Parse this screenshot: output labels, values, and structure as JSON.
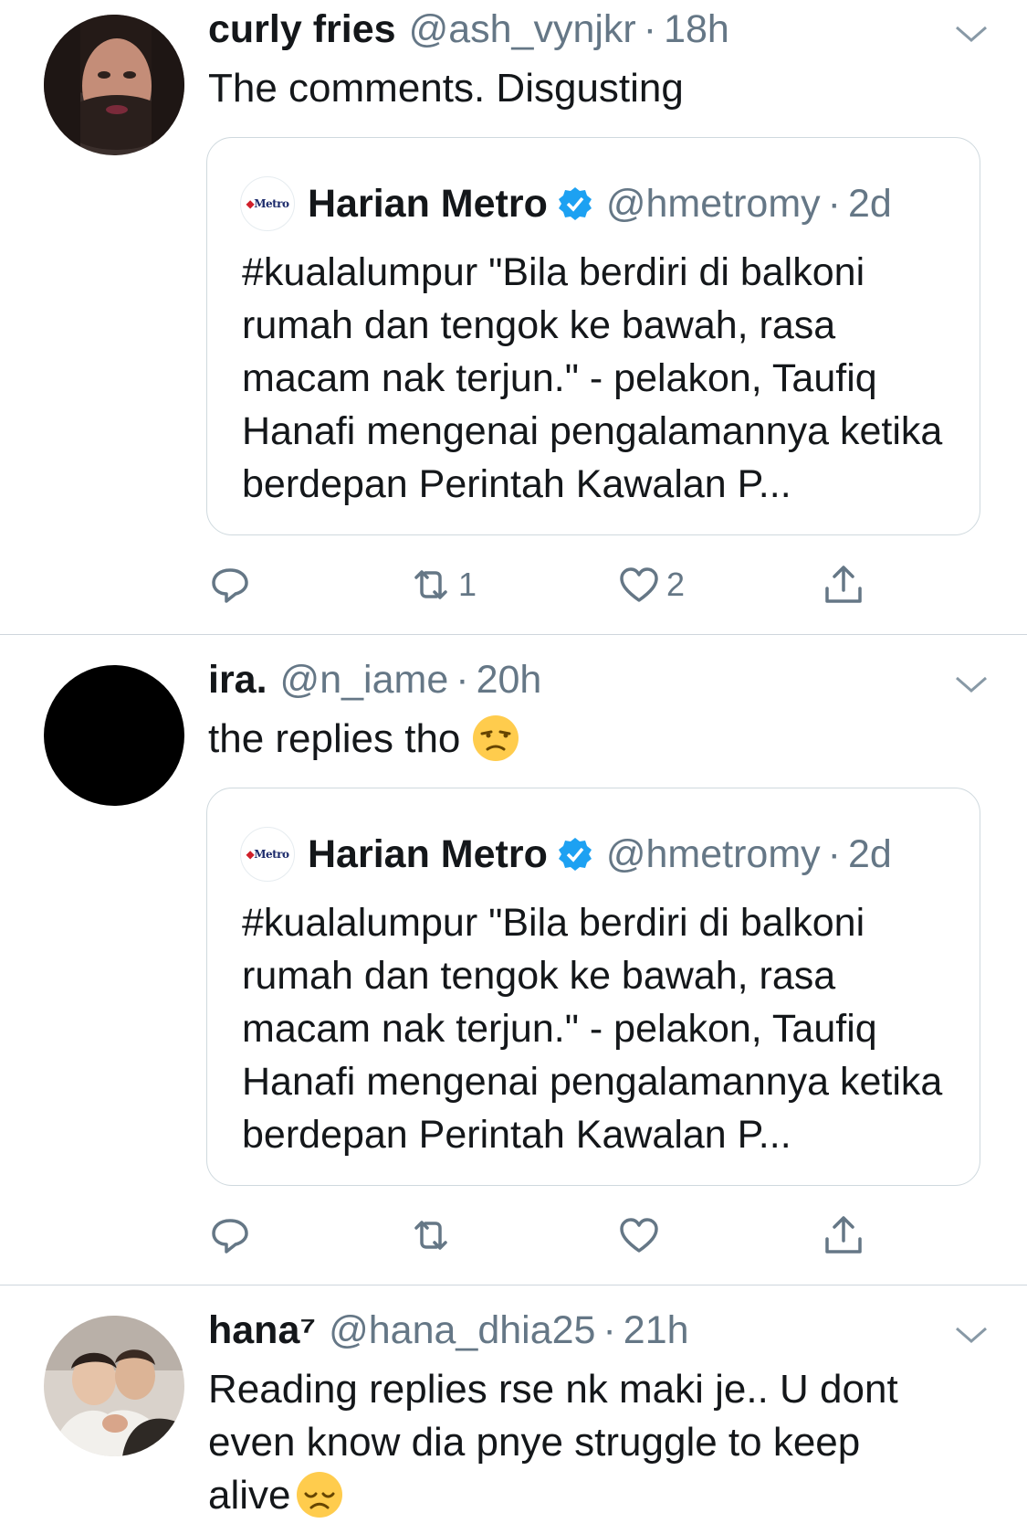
{
  "tweets": [
    {
      "name": "curly fries",
      "handle": "@ash_vynjkr",
      "time": "18h",
      "text": "The comments. Disgusting",
      "quote": {
        "logo_text": "Metro",
        "name": "Harian Metro",
        "handle": "@hmetromy",
        "time": "2d",
        "text": "#kualalumpur \"Bila berdiri di balkoni rumah dan tengok ke bawah, rasa macam nak terjun.\" - pelakon, Taufiq Hanafi mengenai pengalamannya ketika berdepan Perintah Kawalan P..."
      },
      "actions": {
        "reply": "",
        "retweet": "1",
        "like": "2"
      }
    },
    {
      "name": "ira.",
      "handle": "@n_iame",
      "time": "20h",
      "text": "the replies tho",
      "emoji": "unamused-face",
      "quote": {
        "logo_text": "Metro",
        "name": "Harian Metro",
        "handle": "@hmetromy",
        "time": "2d",
        "text": "#kualalumpur \"Bila berdiri di balkoni rumah dan tengok ke bawah, rasa macam nak terjun.\" - pelakon, Taufiq Hanafi mengenai pengalamannya ketika berdepan Perintah Kawalan P..."
      },
      "actions": {
        "reply": "",
        "retweet": "",
        "like": ""
      }
    },
    {
      "name": "hana⁷",
      "handle": "@hana_dhia25",
      "time": "21h",
      "text": "Reading replies rse nk maki je.. U dont even know dia pnye struggle to keep alive",
      "emoji": "disappointed-face"
    }
  ],
  "separator": "·",
  "colors": {
    "secondary": "#657786",
    "verified": "#1da1f2",
    "border": "#cfd9de"
  }
}
